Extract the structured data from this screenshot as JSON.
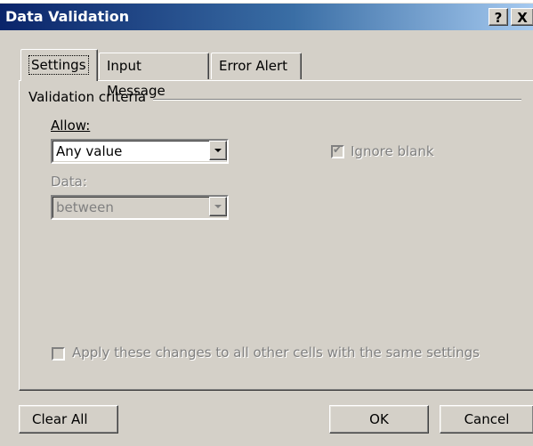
{
  "window": {
    "title": "Data Validation",
    "help_label": "?",
    "close_label": "X"
  },
  "tabs": [
    {
      "label": "Settings",
      "selected": true
    },
    {
      "label": "Input Message",
      "selected": false
    },
    {
      "label": "Error Alert",
      "selected": false
    }
  ],
  "settings": {
    "group_label": "Validation criteria",
    "allow_label": "Allow:",
    "allow_value": "Any value",
    "data_label": "Data:",
    "data_value": "between",
    "ignore_blank_label": "Ignore blank",
    "ignore_blank_checked": true,
    "apply_all_label": "Apply these changes to all other cells with the same settings",
    "apply_all_checked": false
  },
  "buttons": {
    "clear_all": "Clear All",
    "ok": "OK",
    "cancel": "Cancel"
  },
  "colors": {
    "dialog_bg": "#d4d0c8",
    "titlebar_start": "#0a246a",
    "titlebar_end": "#a6caf0",
    "disabled_text": "#808080"
  }
}
